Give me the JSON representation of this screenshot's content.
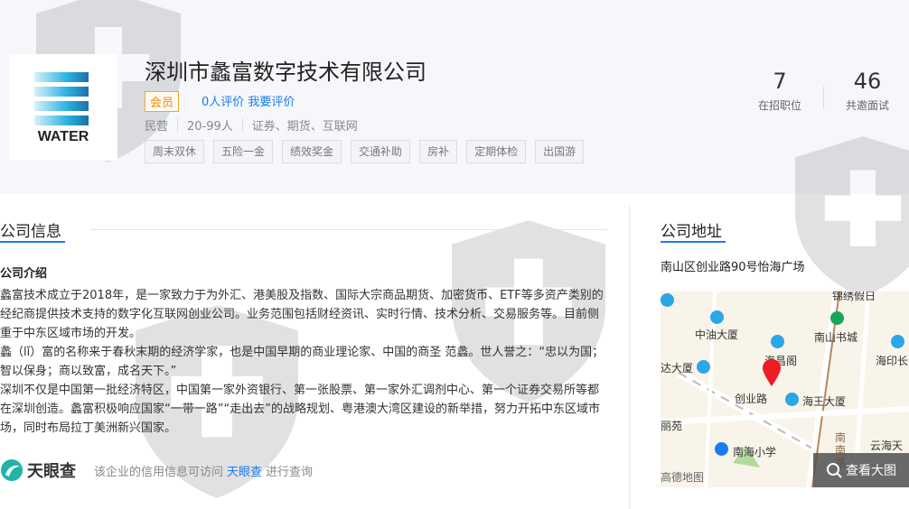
{
  "company": {
    "name": "深圳市蠡富数字技术有限公司",
    "logo_text": "WATER",
    "member_badge": "会员",
    "review_count": "0人评价",
    "write_review": "我要评价",
    "ownership": "民营",
    "size": "20-99人",
    "industry": "证券、期货、互联网",
    "tags": [
      "周末双休",
      "五险一金",
      "绩效奖金",
      "交通补助",
      "房补",
      "定期体检",
      "出国游"
    ]
  },
  "stats": [
    {
      "value": "7",
      "label": "在招职位"
    },
    {
      "value": "46",
      "label": "共邀面试"
    }
  ],
  "info": {
    "heading": "公司信息",
    "intro_title": "公司介绍",
    "paragraphs": [
      "蠡富技术成立于2018年，是一家致力于为外汇、港美股及指数、国际大宗商品期货、加密货币、ETF等多资产类别的经纪商提供技术支持的数字化互联网创业公司。业务范围包括财经资讯、实时行情、技术分析、交易服务等。目前侧重于中东区域市场的开发。",
      "蠡（lǐ）富的名称来于春秋末期的经济学家，也是中国早期的商业理论家、中国的商圣 范蠡。世人誉之：“忠以为国；智以保身；商以致富，成名天下。”",
      "深圳不仅是中国第一批经济特区，中国第一家外资银行、第一张股票、第一家外汇调剂中心、第一个证券交易所等都在深圳创造。蠡富积极响应国家“一带一路”“走出去”的战略规划、粤港澳大湾区建设的新举措，努力开拓中东区域市场，同时布局拉丁美洲新兴国家。"
    ],
    "footer": {
      "brand": "天眼查",
      "text_before": "该企业的信用信息可访问",
      "link": "天眼查",
      "text_after": "进行查询"
    }
  },
  "address": {
    "heading": "公司地址",
    "text": "南山区创业路90号怡海广场",
    "view_map": "查看大图",
    "map_labels": [
      "中油大厦",
      "南山书城",
      "海昌阁",
      "海印长",
      "达大厦",
      "创业路",
      "海王大厦",
      "丽苑",
      "南海小学",
      "南南路",
      "高德地图",
      "云海天",
      "锦绣假日"
    ]
  }
}
